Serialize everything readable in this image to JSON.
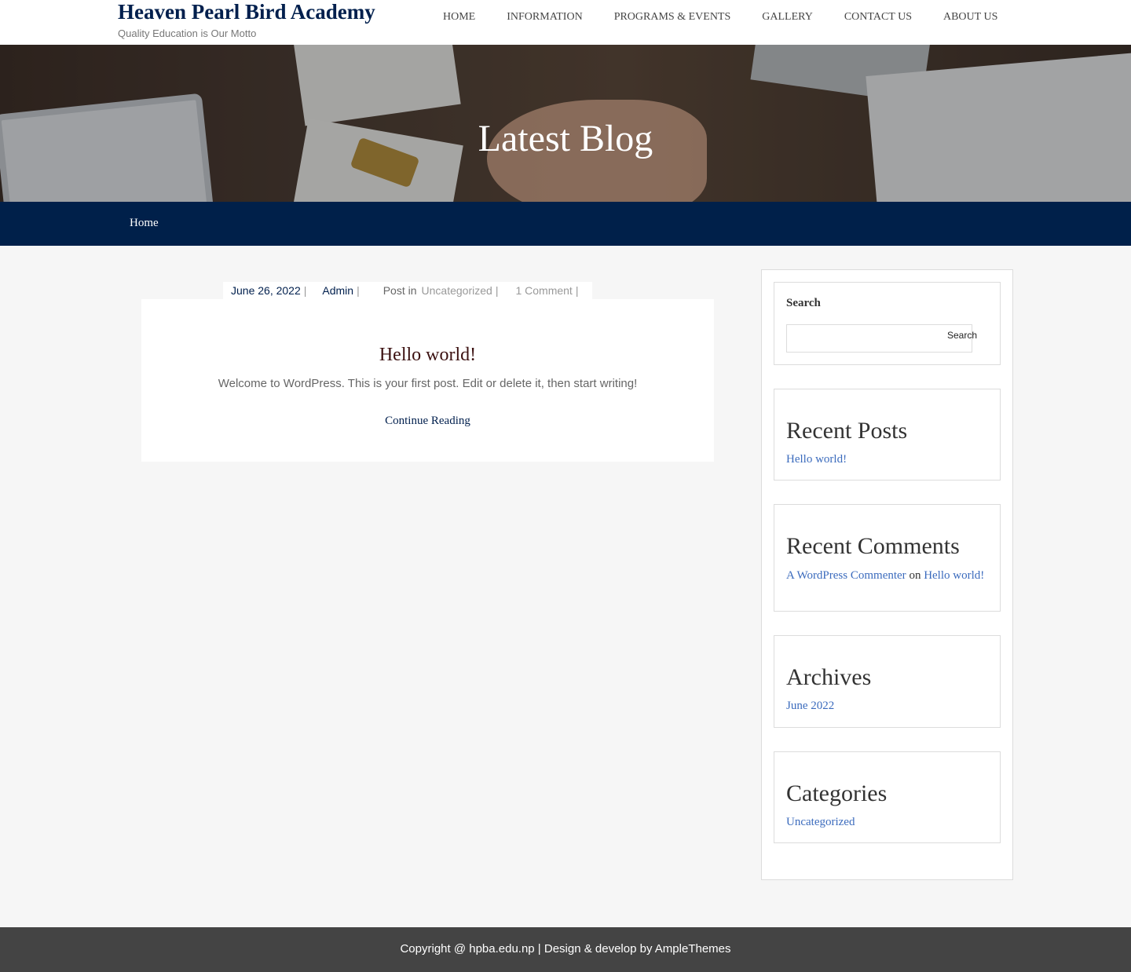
{
  "site": {
    "title": "Heaven Pearl Bird Academy",
    "tagline": "Quality Education is Our Motto"
  },
  "nav": {
    "items": [
      "HOME",
      "INFORMATION",
      "PROGRAMS & EVENTS",
      "GALLERY",
      "CONTACT US",
      "ABOUT US"
    ]
  },
  "hero": {
    "title": "Latest Blog"
  },
  "breadcrumb": {
    "home": "Home"
  },
  "post": {
    "date": "June 26, 2022",
    "author": "Admin",
    "post_in_label": "Post in",
    "category": "Uncategorized",
    "comments": "1 Comment",
    "title": "Hello world!",
    "excerpt": "Welcome to WordPress. This is your first post. Edit or delete it, then start writing!",
    "continue": "Continue Reading"
  },
  "sidebar": {
    "search": {
      "title": "Search",
      "button": "Search",
      "placeholder": ""
    },
    "recent_posts": {
      "title": "Recent Posts",
      "items": [
        "Hello world!"
      ]
    },
    "recent_comments": {
      "title": "Recent Comments",
      "author": "A WordPress Commenter",
      "on": "on",
      "post": "Hello world!"
    },
    "archives": {
      "title": "Archives",
      "items": [
        "June 2022"
      ]
    },
    "categories": {
      "title": "Categories",
      "items": [
        "Uncategorized"
      ]
    }
  },
  "footer": {
    "text": "Copyright @ hpba.edu.np | Design & develop by AmpleThemes"
  },
  "colors": {
    "brand_navy": "#001f4d",
    "link_blue": "#3b6bbd",
    "footer_bg": "#444444"
  }
}
